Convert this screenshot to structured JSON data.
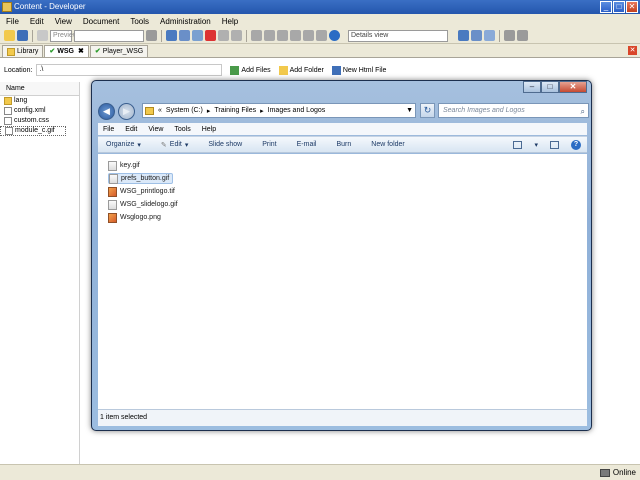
{
  "app": {
    "title": "Content - Developer",
    "menu": [
      "File",
      "Edit",
      "View",
      "Document",
      "Tools",
      "Administration",
      "Help"
    ],
    "toolbar": {
      "preview_label": "Preview",
      "view_select": "Details view"
    },
    "tabs": [
      {
        "label": "Library",
        "active": false
      },
      {
        "label": "WSG",
        "active": true
      },
      {
        "label": "Player_WSG",
        "active": false
      }
    ],
    "location_label": "Location:",
    "location_value": ".\\",
    "actions": {
      "add_files": "Add Files",
      "add_folder": "Add Folder",
      "new_html": "New Html File"
    },
    "left_header": "Name",
    "left_files": [
      "lang",
      "config.xml",
      "custom.css",
      "module_c.gif"
    ],
    "status_online": "Online"
  },
  "explorer": {
    "breadcrumb": [
      "«",
      "System (C:)",
      "Training Files",
      "Images and Logos"
    ],
    "search_placeholder": "Search Images and Logos",
    "menu": [
      "File",
      "Edit",
      "View",
      "Tools",
      "Help"
    ],
    "commands": [
      "Organize",
      "Edit",
      "Slide show",
      "Print",
      "E-mail",
      "Burn",
      "New folder"
    ],
    "files": [
      {
        "name": "key.gif",
        "type": "doc",
        "selected": false
      },
      {
        "name": "prefs_button.gif",
        "type": "doc",
        "selected": true
      },
      {
        "name": "WSG_printlogo.tif",
        "type": "img",
        "selected": false
      },
      {
        "name": "WSG_slidelogo.gif",
        "type": "doc",
        "selected": false
      },
      {
        "name": "Wsglogo.png",
        "type": "img",
        "selected": false
      }
    ],
    "status": "1 item selected"
  }
}
